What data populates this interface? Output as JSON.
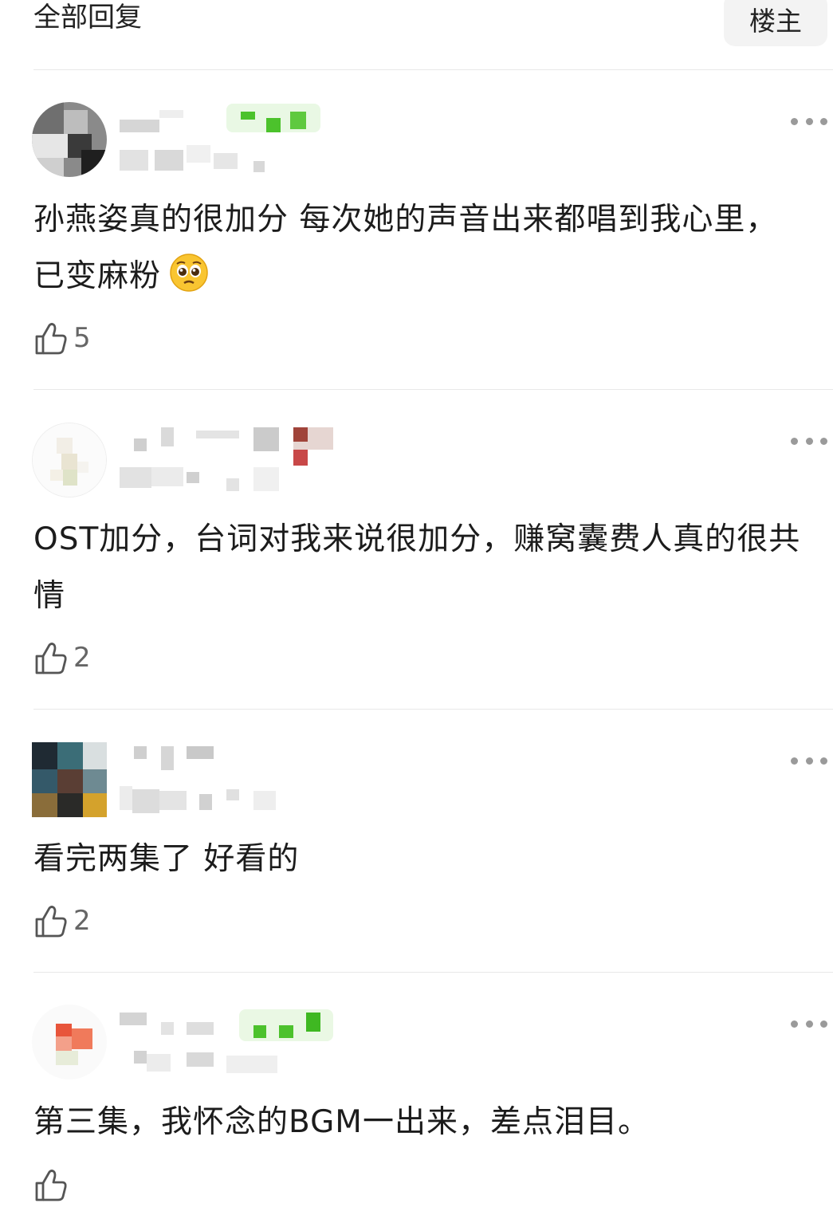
{
  "header": {
    "title": "全部回复",
    "filter_label": "楼主"
  },
  "comments": [
    {
      "text": "孙燕姿真的很加分 每次她的声音出来都唱到我心里，已变麻粉",
      "emoji": "pleading-face-emoji",
      "likes": "5"
    },
    {
      "text": "OST加分，台词对我来说很加分，赚窝囊费人真的很共情",
      "likes": "2"
    },
    {
      "text": "看完两集了 好看的",
      "likes": "2"
    },
    {
      "text": "第三集，我怀念的BGM一出来，差点泪目。",
      "likes": ""
    }
  ],
  "icons": {
    "like": "thumbs-up-icon",
    "more": "more-dots-icon"
  },
  "colors": {
    "badge_green": "#4cc22c",
    "divider": "#e8e8e8",
    "meta_gray": "#9a9a9a"
  }
}
